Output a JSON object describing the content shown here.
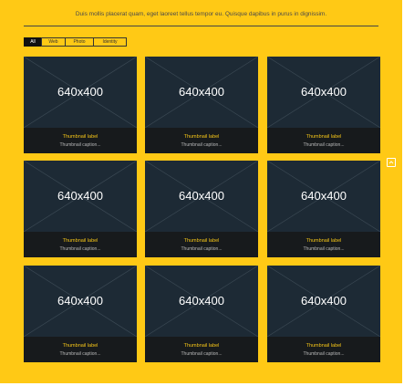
{
  "intro_text": "Duis mollis placerat quam, eget laoreet tellus tempor eu. Quisque dapibus in purus in dignissim.",
  "filters": [
    {
      "label": "All",
      "active": true
    },
    {
      "label": "Web",
      "active": false
    },
    {
      "label": "Photo",
      "active": false
    },
    {
      "label": "Identity",
      "active": false
    }
  ],
  "cards": [
    {
      "dim": "640x400",
      "label": "Thumbnail label",
      "caption": "Thumbnail caption..."
    },
    {
      "dim": "640x400",
      "label": "Thumbnail label",
      "caption": "Thumbnail caption..."
    },
    {
      "dim": "640x400",
      "label": "Thumbnail label",
      "caption": "Thumbnail caption..."
    },
    {
      "dim": "640x400",
      "label": "Thumbnail label",
      "caption": "Thumbnail caption..."
    },
    {
      "dim": "640x400",
      "label": "Thumbnail label",
      "caption": "Thumbnail caption..."
    },
    {
      "dim": "640x400",
      "label": "Thumbnail label",
      "caption": "Thumbnail caption..."
    },
    {
      "dim": "640x400",
      "label": "Thumbnail label",
      "caption": "Thumbnail caption..."
    },
    {
      "dim": "640x400",
      "label": "Thumbnail label",
      "caption": "Thumbnail caption..."
    },
    {
      "dim": "640x400",
      "label": "Thumbnail label",
      "caption": "Thumbnail caption..."
    }
  ],
  "scroll_top_icon": "chevron-up-icon",
  "colors": {
    "background": "#ffc915",
    "card": "#1d2a35",
    "caption_bar": "#171a1c",
    "label": "#f5c518"
  }
}
